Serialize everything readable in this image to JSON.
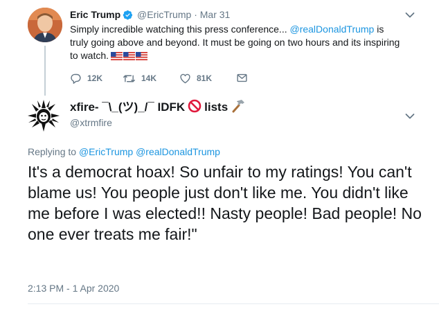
{
  "parent_tweet": {
    "display_name": "Eric Trump",
    "handle": "@EricTrump",
    "separator": "·",
    "date": "Mar 31",
    "body_before": "Simply incredible watching this press conference... ",
    "body_mention": "@realDonaldTrump",
    "body_after": " is truly going above and beyond. It must be going on two hours and its inspiring to watch.",
    "stats": {
      "replies": "12K",
      "retweets": "14K",
      "likes": "81K"
    }
  },
  "reply_tweet": {
    "display_name_part1": "xfire- ¯\\_(ツ)_/¯ IDFK",
    "display_name_part2": "lists",
    "handle": "@xtrmfire",
    "replying_prefix": "Replying to",
    "replying_to_1": "@EricTrump",
    "replying_to_2": "@realDonaldTrump",
    "body": "It's a democrat hoax! So unfair to my ratings! You can't blame us! You people just don't like me. You didn't like me before I was elected!! Nasty people! Bad people! No one ever treats me fair!\"",
    "timestamp": "2:13 PM - 1 Apr 2020"
  },
  "colors": {
    "primary_text": "#14171a",
    "secondary_text": "#657786",
    "link": "#1b95e0",
    "verified": "#1da1f2",
    "thread_line": "#c4cfd6"
  },
  "icons": {
    "verified": "verified-badge-icon",
    "flags": "us-flag-icon",
    "reply": "reply-icon",
    "retweet": "retweet-icon",
    "like": "heart-icon",
    "dm": "envelope-icon",
    "prohibited": "prohibited-icon",
    "hammer": "hammer-icon",
    "more": "chevron-down-icon"
  }
}
